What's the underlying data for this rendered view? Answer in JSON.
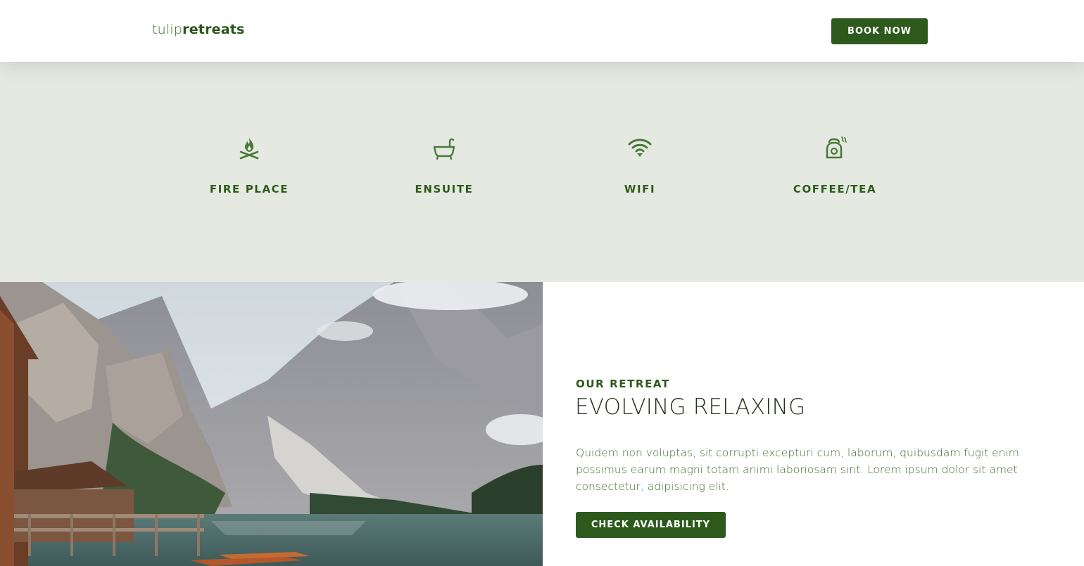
{
  "brand": {
    "logo_light": "tulip",
    "logo_bold": "retreats"
  },
  "header": {
    "book_label": "BOOK NOW"
  },
  "amenities": [
    {
      "label": "FIRE PLACE",
      "icon": "campfire-icon"
    },
    {
      "label": "ENSUITE",
      "icon": "bathtub-icon"
    },
    {
      "label": "WIFI",
      "icon": "wifi-icon"
    },
    {
      "label": "COFFEE/TEA",
      "icon": "kettle-icon"
    }
  ],
  "retreat": {
    "eyebrow": "OUR RETREAT",
    "headline": "EVOLVING RELAXING",
    "body": "Quidem non voluptas, sit corrupti excepturi cum, laborum, quibusdam fugit enim possimus earum magni totam animi laboriosam sint. Lorem ipsum dolor sit amet consectetur, adipisicing elit.",
    "cta_label": "CHECK AVAILABILITY"
  },
  "colors": {
    "brand_green": "#2d5a1c",
    "icon_green": "#4a7a3a",
    "amenities_bg": "#e5e9e1"
  }
}
